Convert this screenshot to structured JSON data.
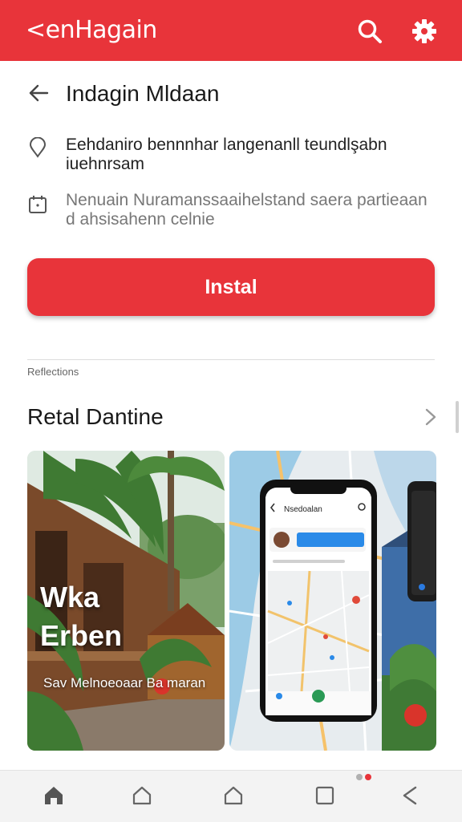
{
  "appbar": {
    "title": "<enHagain",
    "icons": [
      "search-icon",
      "gear-icon"
    ]
  },
  "app": {
    "name": "Indagin Mldaan"
  },
  "info": {
    "location_line1": "Eehdaniro bennnhar langenanll teundlşabn",
    "location_line2": "iuehnrsam",
    "calendar_line1": "Nenuain Nuramanssaaihelstand saera partieaan",
    "calendar_line2": "d ahsisahenn celnie"
  },
  "install": {
    "label": "Instal"
  },
  "section": {
    "label": "Reflections",
    "title": "Retal Dantine"
  },
  "screenshots": {
    "first": {
      "title_line1": "Wka",
      "title_line2": "Erben",
      "subtitle": "Sav Melnoeoaar Ba   maran"
    },
    "phone": {
      "header": "Nsedoalan"
    }
  },
  "nav": {
    "items": [
      "home-icon",
      "home-outline-icon",
      "home-outline-icon",
      "square-icon",
      "back-icon"
    ]
  },
  "colors": {
    "accent": "#e8343a"
  }
}
